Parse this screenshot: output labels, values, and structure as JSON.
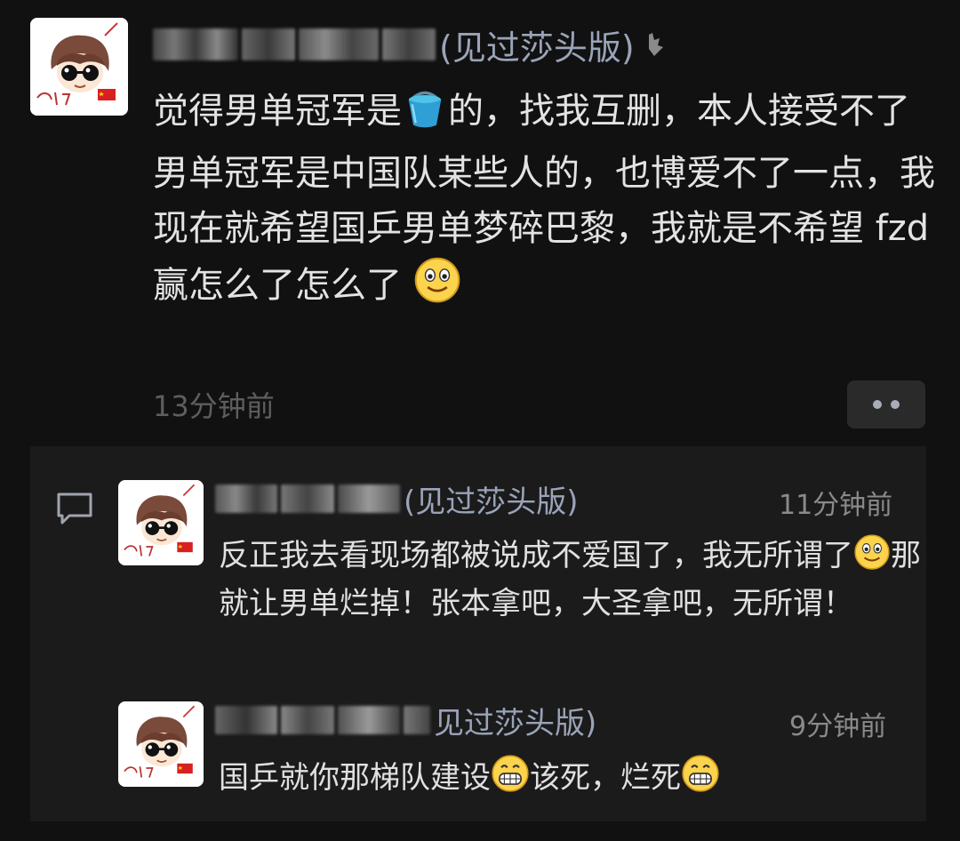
{
  "post": {
    "author_suffix": "(见过莎头版)",
    "text_parts": [
      "觉得男单冠军是",
      "的，找我互删，本人接受不了男单冠军是中国队某些人的，也博爱不了一点，我现在就希望国乒男单梦碎巴黎，我就是不希望 fzd 赢怎么了怎么了"
    ],
    "time": "13分钟前"
  },
  "comments": [
    {
      "author_suffix": "(见过莎头版)",
      "time": "11分钟前",
      "text_parts": [
        "反正我去看现场都被说成不爱国了，我无所谓了",
        "那就让男单烂掉！张本拿吧，大圣拿吧，无所谓！"
      ]
    },
    {
      "author_suffix": "见过莎头版)",
      "time": "9分钟前",
      "text_parts": [
        "国乒就你那梯队建设",
        "该死，烂死"
      ]
    }
  ],
  "icons": {
    "more": "more-dots-icon",
    "comment": "comment-bubble-icon",
    "bucket": "bucket-emoji",
    "smile": "smile-emoji",
    "grin": "grin-emoji"
  },
  "colors": {
    "background": "#111111",
    "panel": "#1b1b1b",
    "name": "#9aa3b8",
    "text": "#e3e3e3",
    "muted": "#5e5e5e"
  }
}
